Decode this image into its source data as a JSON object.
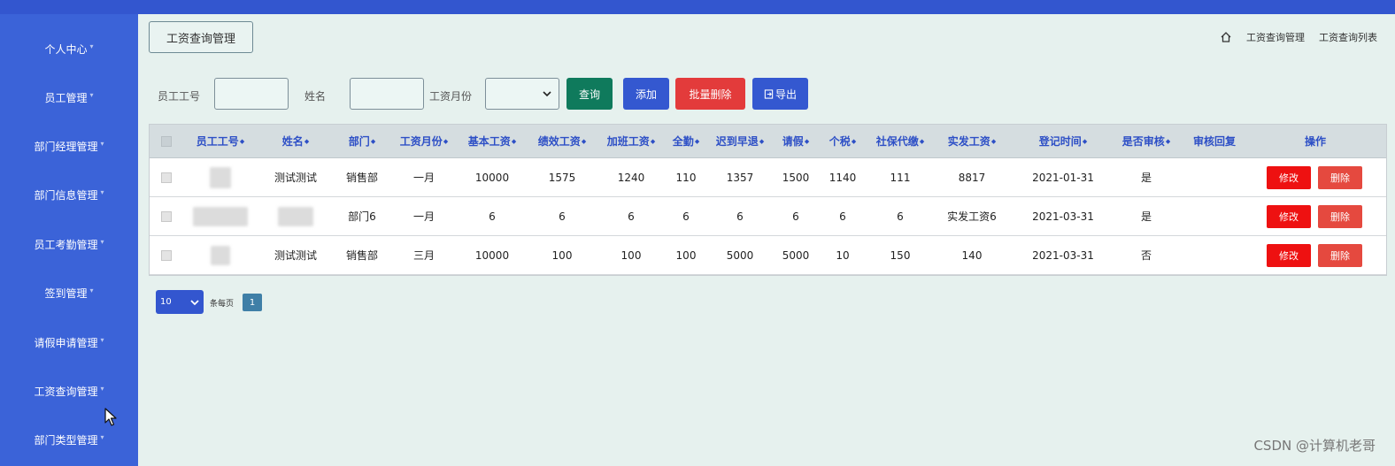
{
  "sidebar": {
    "items": [
      {
        "label": "个人中心"
      },
      {
        "label": "员工管理"
      },
      {
        "label": "部门经理管理"
      },
      {
        "label": "部门信息管理"
      },
      {
        "label": "员工考勤管理"
      },
      {
        "label": "签到管理"
      },
      {
        "label": "请假申请管理"
      },
      {
        "label": "工资查询管理"
      },
      {
        "label": "部门类型管理"
      }
    ],
    "caret": "▾"
  },
  "header": {
    "page_title": "工资查询管理",
    "breadcrumb": [
      "工资查询管理",
      "工资查询列表"
    ],
    "home_icon": "home-icon"
  },
  "search": {
    "emp_no_label": "员工工号",
    "name_label": "姓名",
    "month_label": "工资月份",
    "emp_no_value": "",
    "name_value": "",
    "month_value": "",
    "query_btn": "查询",
    "add_btn": "添加",
    "batch_delete_btn": "批量删除",
    "export_btn": "导出"
  },
  "table": {
    "headers": [
      "员工工号",
      "姓名",
      "部门",
      "工资月份",
      "基本工资",
      "绩效工资",
      "加班工资",
      "全勤",
      "迟到早退",
      "请假",
      "个税",
      "社保代缴",
      "实发工资",
      "登记时间",
      "是否审核",
      "审核回复",
      "操作"
    ],
    "sort_icon": "◆",
    "rows": [
      {
        "emp_no": "",
        "name": "测试测试",
        "dept": "销售部",
        "month": "一月",
        "base": "10000",
        "perf": "1575",
        "overtime": "1240",
        "attend": "110",
        "late": "1357",
        "leave": "1500",
        "tax": "1140",
        "social": "111",
        "net": "8817",
        "date": "2021-01-31",
        "audited": "是",
        "reply": ""
      },
      {
        "emp_no": "",
        "name": "",
        "dept": "部门6",
        "month": "一月",
        "base": "6",
        "perf": "6",
        "overtime": "6",
        "attend": "6",
        "late": "6",
        "leave": "6",
        "tax": "6",
        "social": "6",
        "net": "实发工资6",
        "date": "2021-03-31",
        "audited": "是",
        "reply": ""
      },
      {
        "emp_no": "",
        "name": "测试测试",
        "dept": "销售部",
        "month": "三月",
        "base": "10000",
        "perf": "100",
        "overtime": "100",
        "attend": "100",
        "late": "5000",
        "leave": "5000",
        "tax": "10",
        "social": "150",
        "net": "140",
        "date": "2021-03-31",
        "audited": "否",
        "reply": ""
      }
    ],
    "edit_btn": "修改",
    "delete_btn": "删除"
  },
  "pager": {
    "page_size": "10",
    "per_page_text": "条每页",
    "current_page": "1"
  },
  "watermark": "CSDN @计算机老哥",
  "colors": {
    "sidebar": "#3b63d8",
    "topbar": "#3356cf",
    "query": "#0f7a5c",
    "add": "#3458d0",
    "batch_delete": "#e33b3b",
    "export": "#3458d0",
    "edit": "#ee1111",
    "delete": "#e5493f"
  }
}
